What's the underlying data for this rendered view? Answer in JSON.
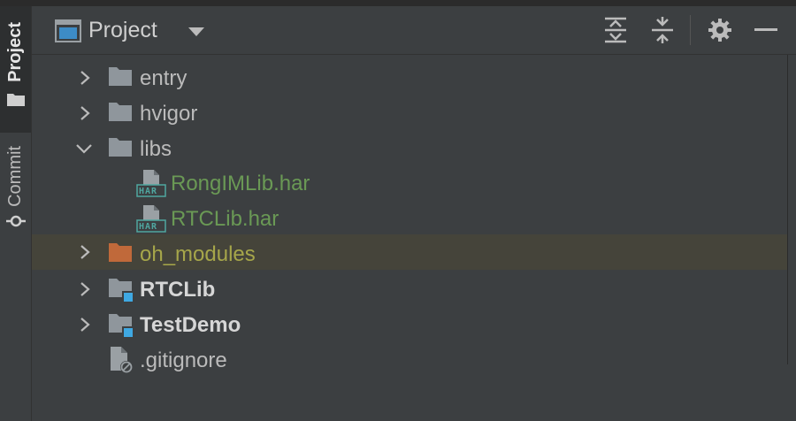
{
  "toolwindow_strip": {
    "project_label": "Project",
    "commit_label": "Commit"
  },
  "header": {
    "title": "Project",
    "dropdown_icon": "triangle-down",
    "actions": [
      "expand-all-icon",
      "collapse-all-icon",
      "gear-icon",
      "hide-icon"
    ]
  },
  "tree": {
    "items": [
      {
        "label": "entry",
        "type": "folder",
        "expanded": false
      },
      {
        "label": "hvigor",
        "type": "folder",
        "expanded": false
      },
      {
        "label": "libs",
        "type": "folder",
        "expanded": true
      },
      {
        "label": "RongIMLib.har",
        "type": "har-file"
      },
      {
        "label": "RTCLib.har",
        "type": "har-file"
      },
      {
        "label": "oh_modules",
        "type": "excluded-folder",
        "expanded": false,
        "selected": true
      },
      {
        "label": "RTCLib",
        "type": "module-folder",
        "expanded": false
      },
      {
        "label": "TestDemo",
        "type": "module-folder",
        "expanded": false
      },
      {
        "label": ".gitignore",
        "type": "ignored-file"
      }
    ],
    "har_badge": "HAR"
  },
  "colors": {
    "background": "#3c3f41",
    "text": "#bbbbbb",
    "har_text": "#6a9955",
    "oh_modules_text": "#a6a64a",
    "oh_modules_folder": "#c0693a",
    "module_badge": "#3fa9e3",
    "selected_row": "#45443a"
  }
}
